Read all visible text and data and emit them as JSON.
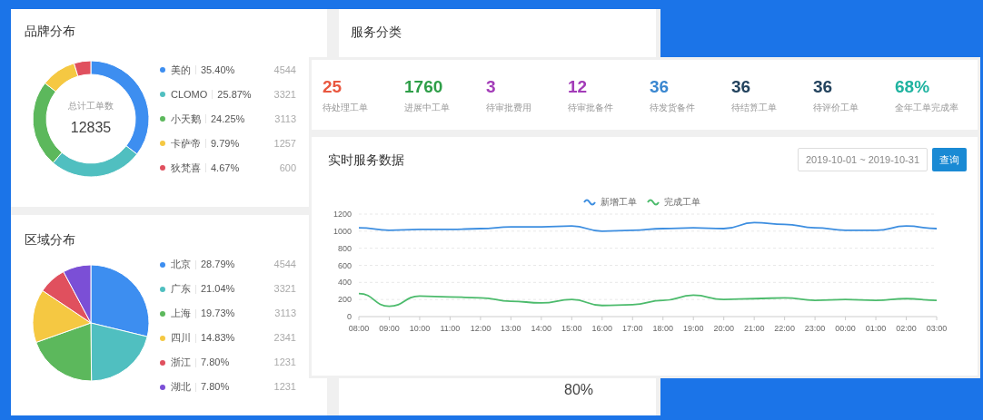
{
  "brand_distribution": {
    "title": "品牌分布",
    "center_label": "总计工单数",
    "center_value": "12835",
    "items": [
      {
        "percent": "35.40%",
        "count": "4544",
        "color": "#3d8ef0"
      },
      {
        "percent": "25.87%",
        "count": "3321",
        "color": "#50bfc0"
      },
      {
        "percent": "24.25%",
        "count": "3113",
        "color": "#5cb85c"
      },
      {
        "percent": "9.79%",
        "count": "1257",
        "color": "#f5c842"
      },
      {
        "percent": "4.67%",
        "count": "600",
        "color": "#e0505e"
      }
    ],
    "chart_data": {
      "type": "donut",
      "categories": [
        "美的",
        "CLOMO",
        "小天鹅",
        "卡萨帝",
        "狄梵喜"
      ],
      "values": [
        35.4,
        25.87,
        24.25,
        9.79,
        4.67
      ]
    }
  },
  "region_distribution": {
    "title": "区域分布",
    "items": [
      {
        "percent": "28.79%",
        "count": "4544",
        "color": "#3d8ef0"
      },
      {
        "percent": "21.04%",
        "count": "3321",
        "color": "#50bfc0"
      },
      {
        "percent": "19.73%",
        "count": "3113",
        "color": "#5cb85c"
      },
      {
        "percent": "14.83%",
        "count": "2341",
        "color": "#f5c842"
      },
      {
        "percent": "7.80%",
        "count": "1231",
        "color": "#e0505e"
      },
      {
        "percent": "7.80%",
        "count": "1231",
        "color": "#7b4fd6"
      }
    ],
    "chart_data": {
      "type": "pie",
      "categories": [
        "北京",
        "广东",
        "上海",
        "四川",
        "浙江",
        "湖北"
      ],
      "values": [
        28.79,
        21.04,
        19.73,
        14.83,
        7.8,
        7.8
      ]
    }
  },
  "service_category": {
    "title": "服务分类",
    "value": "80%"
  },
  "stats": [
    {
      "value": "25",
      "label": "待处理工单",
      "color": "#e9573f"
    },
    {
      "value": "1760",
      "label": "进展中工单",
      "color": "#2e9e48"
    },
    {
      "value": "3",
      "label": "待审批费用",
      "color": "#a33cb8"
    },
    {
      "value": "12",
      "label": "待审批备件",
      "color": "#a33cb8"
    },
    {
      "value": "36",
      "label": "待发货备件",
      "color": "#3a87d0"
    },
    {
      "value": "36",
      "label": "待结算工单",
      "color": "#23435e"
    },
    {
      "value": "36",
      "label": "待评价工单",
      "color": "#23435e"
    },
    {
      "value": "68%",
      "label": "全年工单完成率",
      "color": "#1fb3a0"
    }
  ],
  "realtime": {
    "title": "实时服务数据",
    "date_range": "2019-10-01 ~ 2019-10-31",
    "query_button": "查询",
    "chart_data": {
      "type": "line",
      "categories": [
        "08:00",
        "09:00",
        "10:00",
        "11:00",
        "12:00",
        "13:00",
        "14:00",
        "15:00",
        "16:00",
        "17:00",
        "18:00",
        "19:00",
        "20:00",
        "21:00",
        "22:00",
        "23:00",
        "00:00",
        "01:00",
        "02:00",
        "03:00"
      ],
      "series": [
        {
          "name": "新增工单",
          "color": "#3d8ee0",
          "values": [
            1040,
            1010,
            1020,
            1020,
            1030,
            1050,
            1050,
            1060,
            1000,
            1010,
            1030,
            1040,
            1030,
            1100,
            1080,
            1040,
            1010,
            1010,
            1060,
            1030
          ]
        },
        {
          "name": "完成工单",
          "color": "#4cbb6c",
          "values": [
            270,
            120,
            240,
            230,
            220,
            180,
            160,
            200,
            130,
            140,
            190,
            250,
            200,
            210,
            220,
            190,
            200,
            190,
            210,
            190
          ]
        }
      ],
      "ylim": [
        0,
        1200
      ],
      "yticks": [
        0,
        200,
        400,
        600,
        800,
        1000,
        1200
      ],
      "grid": true,
      "legend": true
    }
  }
}
